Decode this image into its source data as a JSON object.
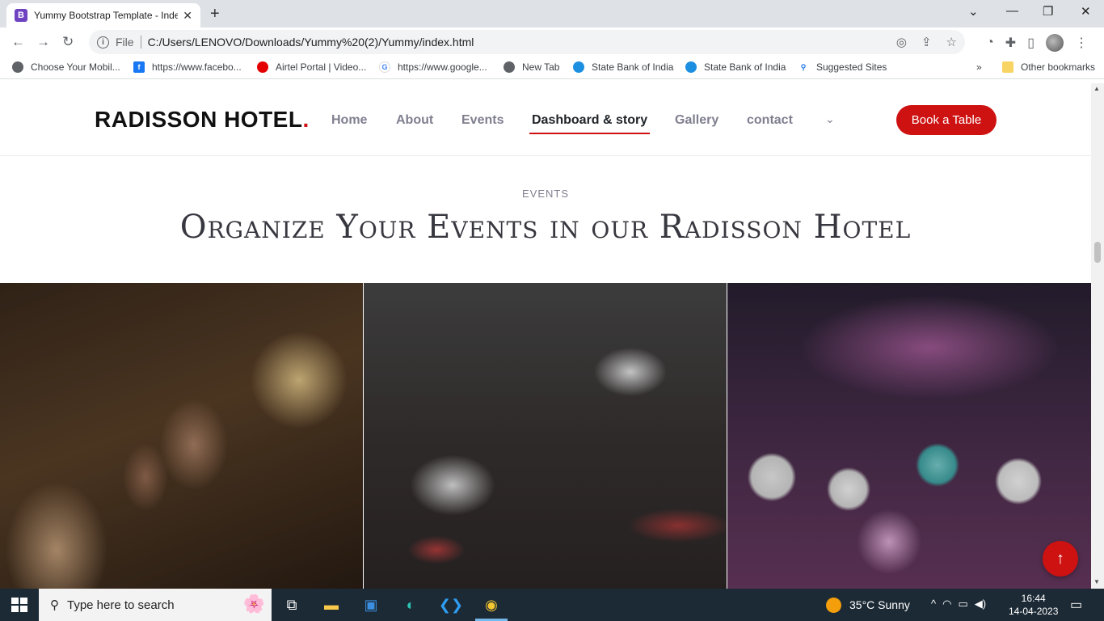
{
  "browser": {
    "tab_title": "Yummy Bootstrap Template - Index",
    "tab_favicon_letter": "B",
    "url_scheme": "File",
    "url": "C:/Users/LENOVO/Downloads/Yummy%20(2)/Yummy/index.html",
    "bookmarks": [
      {
        "label": "Choose Your Mobil...",
        "icon": "globe-icon"
      },
      {
        "label": "https://www.facebo...",
        "icon": "facebook-icon"
      },
      {
        "label": "Airtel Portal | Video...",
        "icon": "airtel-icon"
      },
      {
        "label": "https://www.google...",
        "icon": "google-icon"
      },
      {
        "label": "New Tab",
        "icon": "globe-icon"
      },
      {
        "label": "State Bank of India",
        "icon": "sbi-icon"
      },
      {
        "label": "State Bank of India",
        "icon": "sbi-icon"
      },
      {
        "label": "Suggested Sites",
        "icon": "search-icon"
      }
    ],
    "other_bookmarks": "Other bookmarks"
  },
  "site": {
    "logo_text": "RADISSON HOTEL",
    "logo_dot": ".",
    "nav": [
      "Home",
      "About",
      "Events",
      "Dashboard & story",
      "Gallery",
      "contact"
    ],
    "active_nav": "Dashboard & story",
    "cta": "Book a Table",
    "accent_color": "#ce1212"
  },
  "events": {
    "label": "EVENTS",
    "title": "Organize Your Events in our Radisson Hotel"
  },
  "taskbar": {
    "search_placeholder": "Type here to search",
    "weather": "35°C  Sunny",
    "time": "16:44",
    "date": "14-04-2023"
  }
}
